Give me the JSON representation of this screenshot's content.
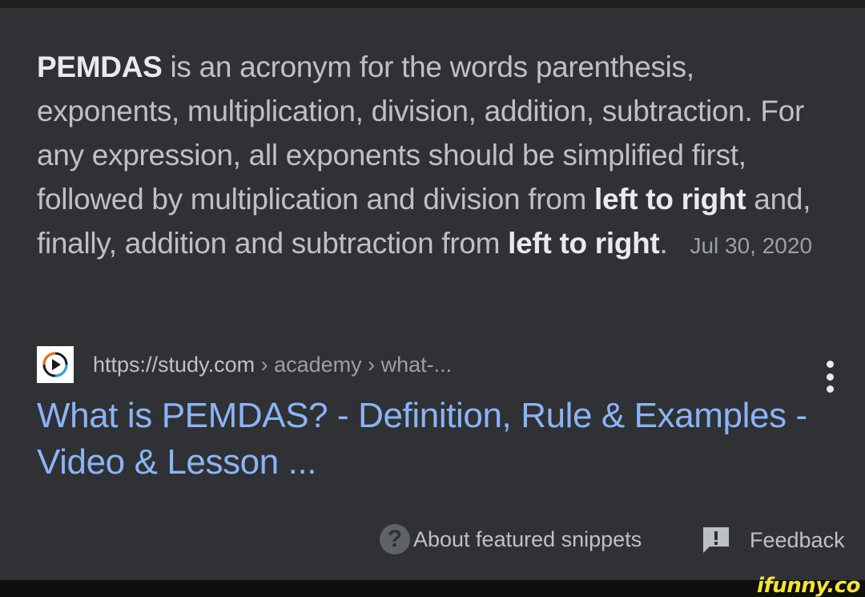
{
  "snippet": {
    "bold_term": "PEMDAS",
    "text_1": " is an acronym for the words parenthesis, exponents, multiplication, division, addition, subtraction. For any expression, all exponents should be simplified first, followed by multiplication and division from ",
    "bold_1": "left to right",
    "text_2": " and, finally, addition and subtraction from ",
    "bold_2": "left to right",
    "text_3": ".",
    "date": "Jul 30, 2020"
  },
  "source": {
    "domain": "https://study.com",
    "breadcrumb": " › academy › what-...",
    "favicon": "study-com-play-icon"
  },
  "result": {
    "title": "What is PEMDAS? - Definition, Rule & Examples - Video & Lesson ..."
  },
  "footer": {
    "about_icon": "?",
    "about_label": "About featured snippets",
    "feedback_label": "Feedback",
    "feedback_icon_mark": "!"
  },
  "watermark": "ifunny.co",
  "colors": {
    "background": "#303134",
    "body_text": "#bdc1c6",
    "bold_text": "#e8eaed",
    "link": "#8ab4f8",
    "watermark": "#f2e33b"
  }
}
